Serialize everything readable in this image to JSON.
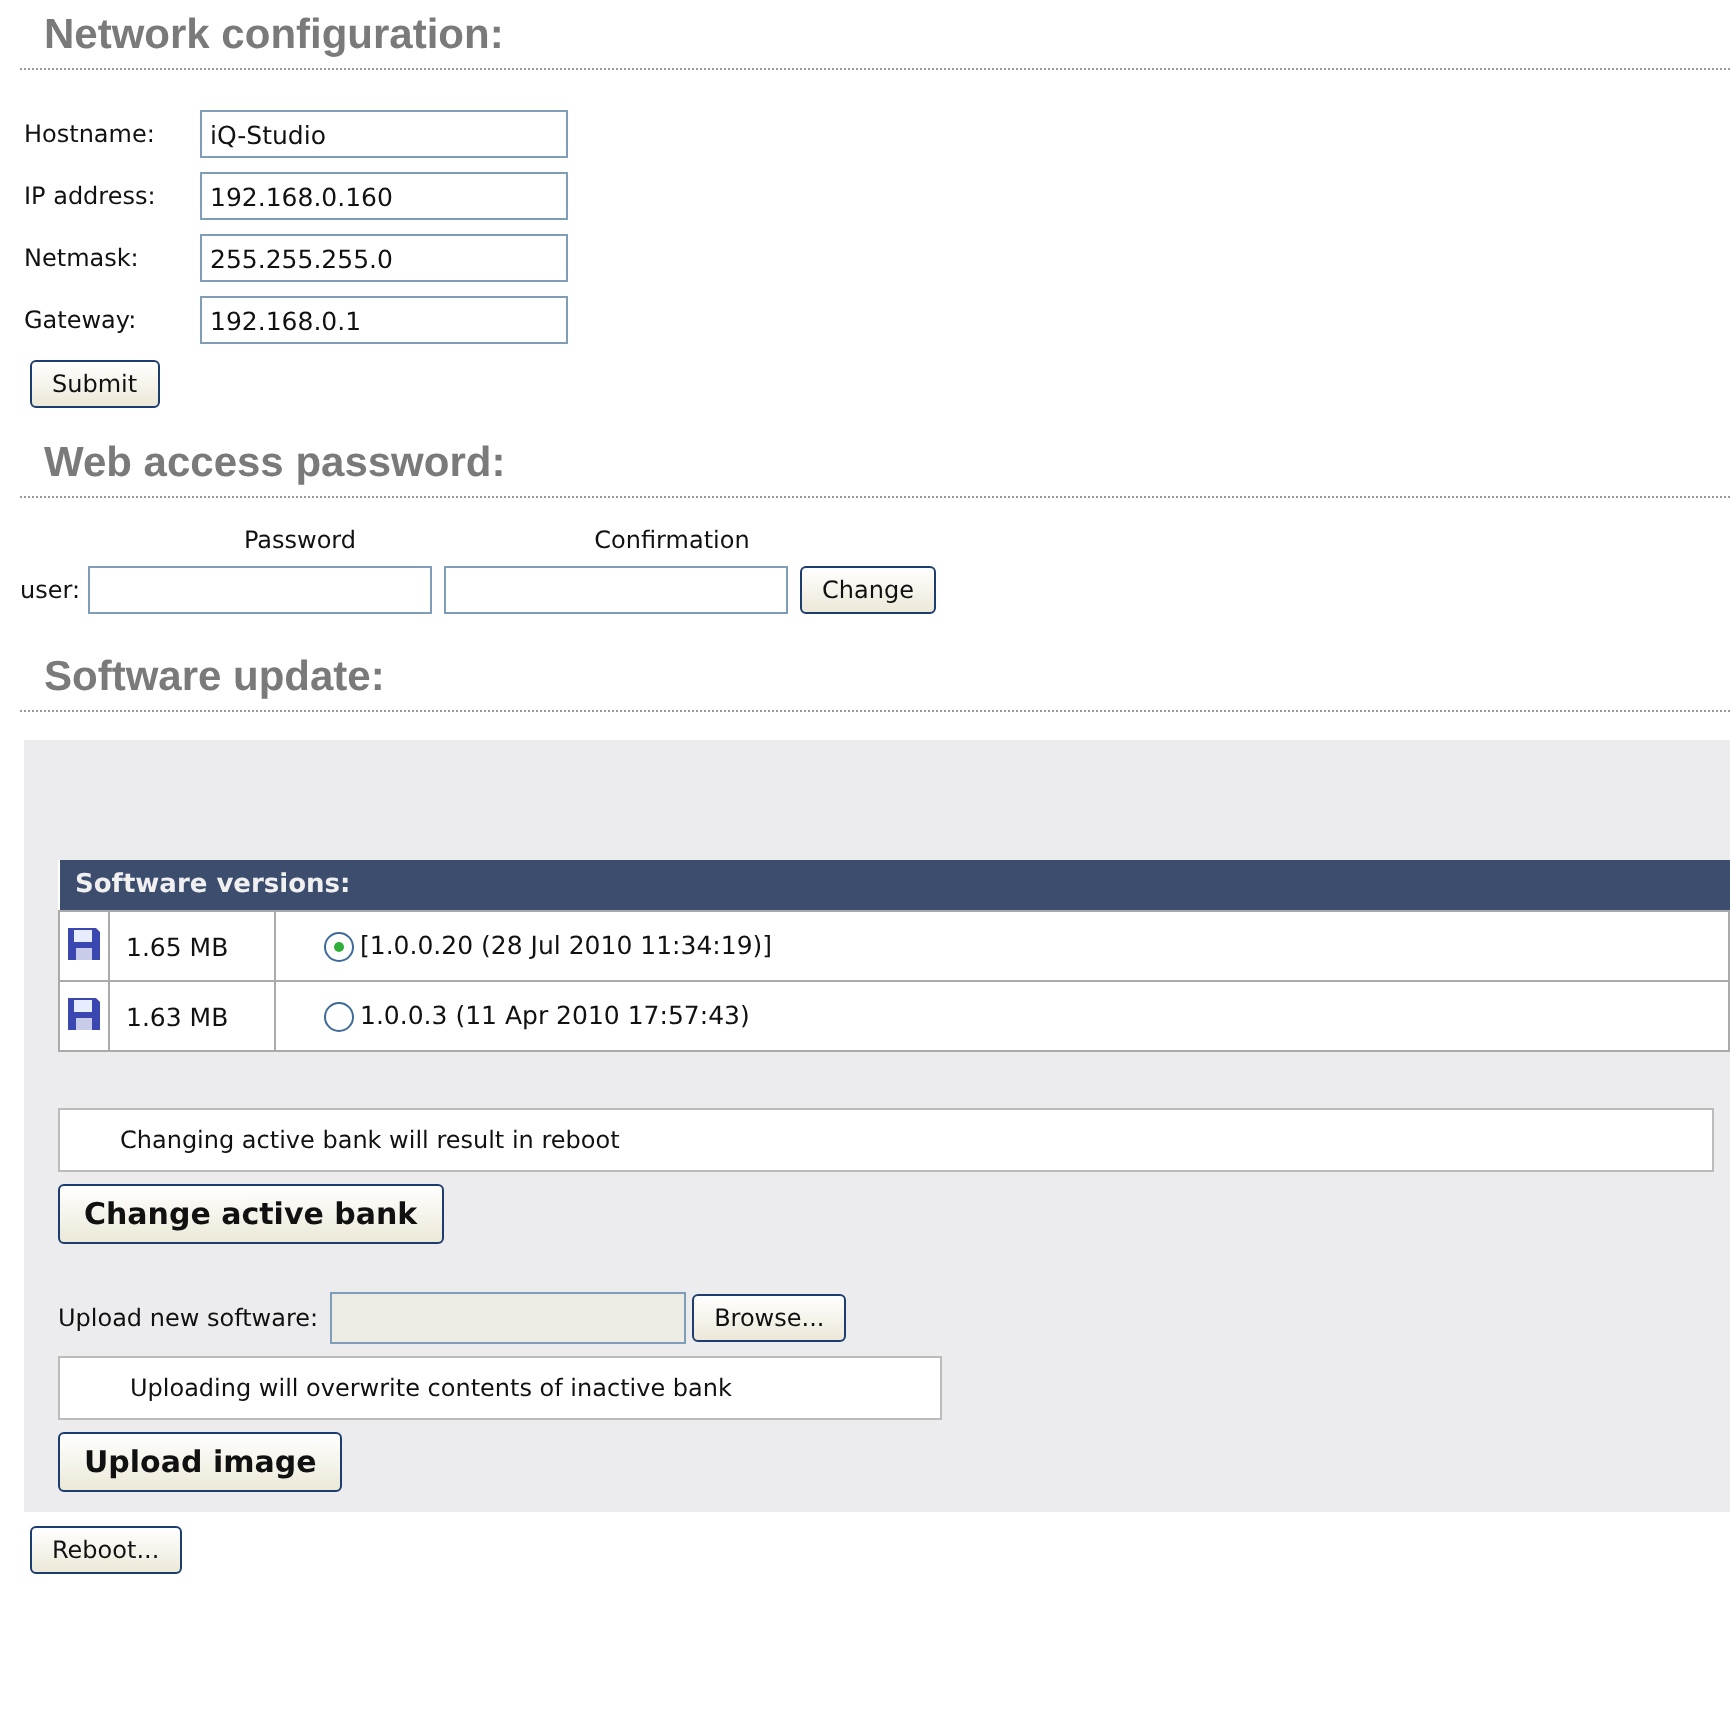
{
  "network": {
    "heading": "Network configuration:",
    "fields": [
      {
        "label": "Hostname:",
        "value": "iQ-Studio"
      },
      {
        "label": "IP address:",
        "value": "192.168.0.160"
      },
      {
        "label": "Netmask:",
        "value": "255.255.255.0"
      },
      {
        "label": "Gateway:",
        "value": "192.168.0.1"
      }
    ],
    "submit": "Submit"
  },
  "password": {
    "heading": "Web access password:",
    "column_labels": [
      "Password",
      "Confirmation"
    ],
    "user_label": "user:",
    "button": "Change"
  },
  "software": {
    "heading": "Software update:",
    "table": {
      "title": "Software versions:",
      "rows": [
        {
          "size": "1.65 MB",
          "version": "[1.0.0.20 (28 Jul 2010 11:34:19)]",
          "selected": true
        },
        {
          "size": "1.63 MB",
          "version": "1.0.0.3 (11 Apr 2010 17:57:43)",
          "selected": false
        }
      ]
    },
    "bank_note": "Changing active bank will result in reboot",
    "bank_button": "Change active bank",
    "upload_label": "Upload new software:",
    "browse_button": "Browse...",
    "upload_note": "Uploading will overwrite contents of inactive bank",
    "upload_button": "Upload image"
  },
  "reboot_button": "Reboot..."
}
